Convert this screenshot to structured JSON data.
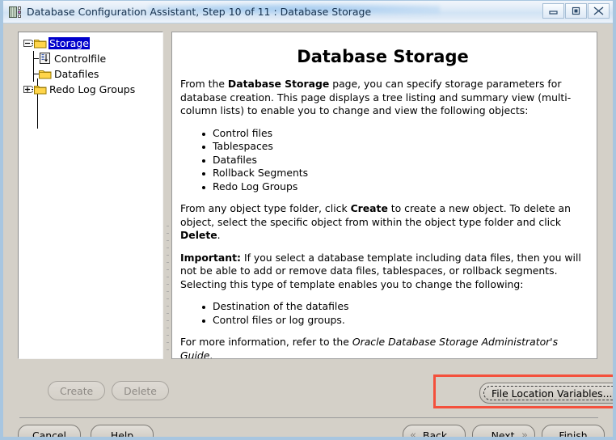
{
  "window": {
    "title": "Database Configuration Assistant, Step 10 of 11 : Database Storage",
    "app_icon": "database-icon",
    "controls": {
      "minimize": "minimize-icon",
      "maximize": "maximize-icon",
      "close": "close-icon"
    }
  },
  "tree": {
    "nodes": [
      {
        "label": "Storage",
        "icon": "folder-icon",
        "handle": "collapse-minus-icon",
        "selected": true,
        "level": 0
      },
      {
        "label": "Controlfile",
        "icon": "controlfile-icon",
        "handle": "none",
        "selected": false,
        "level": 1
      },
      {
        "label": "Datafiles",
        "icon": "folder-icon",
        "handle": "none",
        "selected": false,
        "level": 1
      },
      {
        "label": "Redo Log Groups",
        "icon": "folder-icon",
        "handle": "expand-plus-icon",
        "selected": false,
        "level": 1
      }
    ]
  },
  "doc": {
    "title": "Database Storage",
    "intro_1": "From the ",
    "intro_bold": "Database Storage",
    "intro_2": " page, you can specify storage parameters for database creation. This page displays a tree listing and summary view (multi-column lists) to enable you to change and view the following objects:",
    "object_list": [
      "Control files",
      "Tablespaces",
      "Datafiles",
      "Rollback Segments",
      "Redo Log Groups"
    ],
    "create_delete_1": "From any object type folder, click ",
    "create_delete_bold_1": "Create",
    "create_delete_2": " to create a new object. To delete an object, select the specific object from within the object type folder and click ",
    "create_delete_bold_2": "Delete",
    "create_delete_3": ".",
    "important_bold": "Important:",
    "important_text": " If you select a database template including data files, then you will not be able to add or remove data files, tablespaces, or rollback segments. Selecting this type of template enables you to change the following:",
    "change_list": [
      "Destination of the datafiles",
      "Control files or log groups."
    ],
    "more_info_1": "For more information, refer to the ",
    "more_info_italic": "Oracle Database Storage Administrator's Guide",
    "more_info_2": "."
  },
  "actions": {
    "create_label": "Create",
    "create_enabled": false,
    "delete_label": "Delete",
    "delete_enabled": false,
    "file_location_variables_label": "File Location Variables...",
    "file_location_variables_focused": true,
    "highlight_color": "#f4503c"
  },
  "navigation": {
    "cancel_label": "Cancel",
    "help_label": "Help",
    "back_label": "Back",
    "back_mnemonic": "B",
    "back_icon": "double-chevron-left-icon",
    "next_label": "Next",
    "next_mnemonic": "N",
    "next_icon": "double-chevron-right-icon",
    "finish_label": "Finish",
    "finish_mnemonic": "F"
  }
}
